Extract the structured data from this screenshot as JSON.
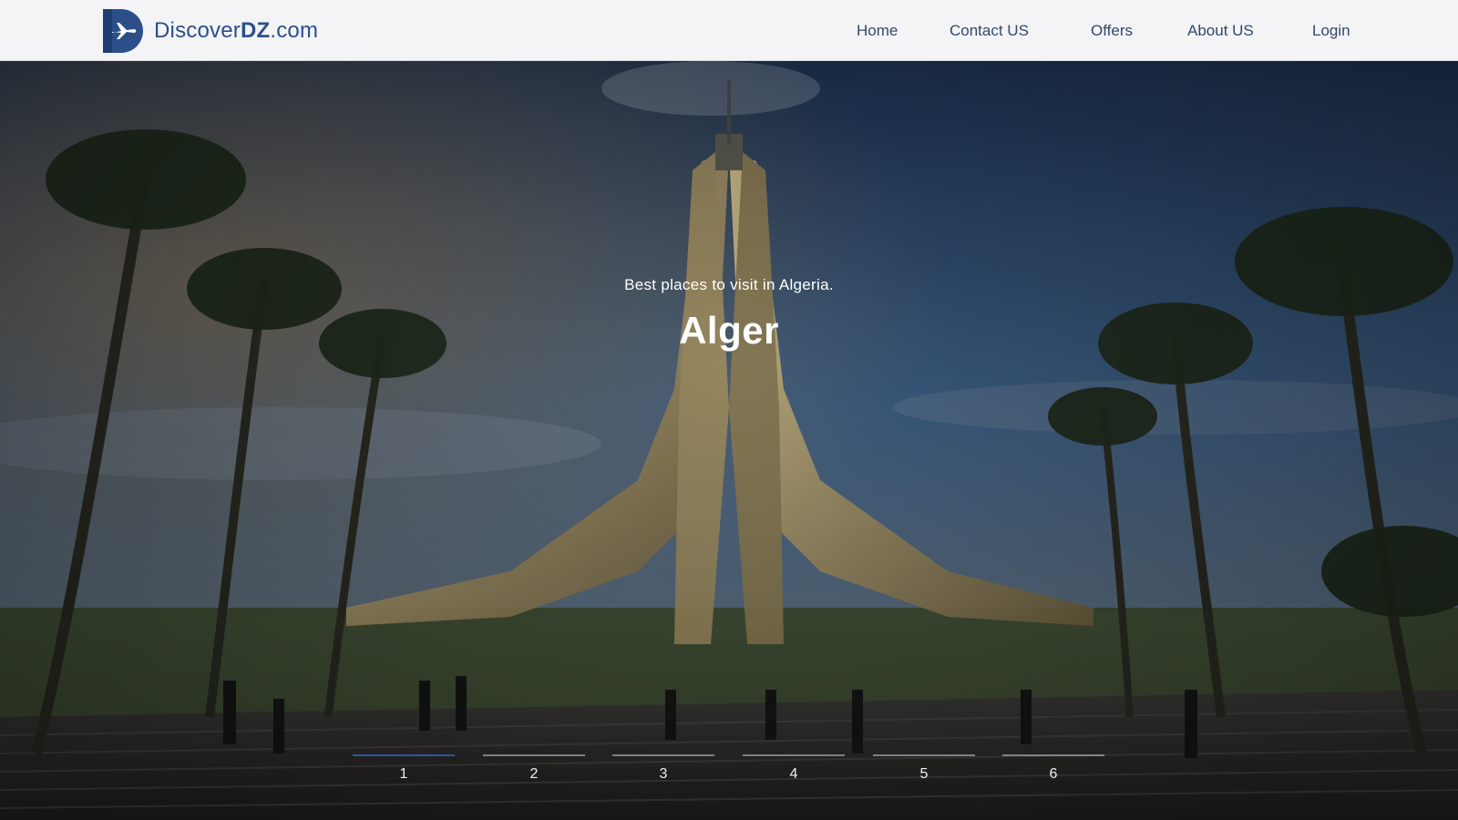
{
  "brand": {
    "name_regular": "Discover",
    "name_bold": "DZ",
    "name_suffix": ".com",
    "logo_icon": "plane-d-logo-icon",
    "color": "#2c4f8a"
  },
  "nav": {
    "items": [
      {
        "label": "Home"
      },
      {
        "label": "Contact US"
      },
      {
        "label": "Offers"
      },
      {
        "label": "About US"
      },
      {
        "label": "Login"
      }
    ]
  },
  "hero": {
    "subtitle": "Best places to visit in Algeria.",
    "title": "Alger"
  },
  "slider": {
    "active_index": 0,
    "active_color": "#2f55a0",
    "items": [
      "1",
      "2",
      "3",
      "4",
      "5",
      "6"
    ]
  }
}
